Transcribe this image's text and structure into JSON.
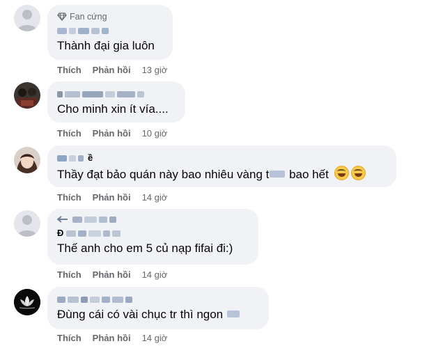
{
  "comments": [
    {
      "badge": "Fan cứng",
      "text": "Thành đại gia luôn",
      "like": "Thích",
      "reply": "Phản hồi",
      "time": "13 giờ"
    },
    {
      "text": "Cho minh xin ít vía....",
      "like": "Thích",
      "reply": "Phản hồi",
      "time": "10 giờ"
    },
    {
      "text_before": "Thầy đạt bảo quán này bao nhiêu vàng t",
      "text_after": " bao hết",
      "like": "Thích",
      "reply": "Phản hồi",
      "time": "14 giờ"
    },
    {
      "text": "Thế anh cho em 5 củ nạp fifai đi:)",
      "like": "Thích",
      "reply": "Phản hồi",
      "time": "14 giờ"
    },
    {
      "text": "Đùng cái có vài chục tr thì ngon",
      "like": "Thích",
      "reply": "Phản hồi",
      "time": "14 giờ"
    }
  ],
  "colors": {
    "bubble": "#f0f2f5",
    "secondary_text": "#65676b",
    "blurred_name": "#a9b8cf"
  },
  "icons": [
    "diamond-icon",
    "grin-emoji-icon"
  ]
}
